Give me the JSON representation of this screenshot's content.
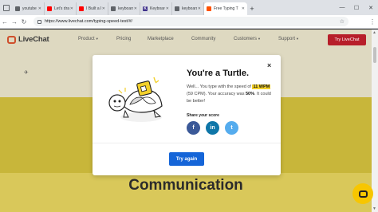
{
  "browser": {
    "tabs": [
      {
        "label": "youtube - Sea",
        "favicon_color": "#5f6368",
        "favicon_glyph": ""
      },
      {
        "label": "Let's draw!",
        "favicon_color": "#ff0000",
        "favicon_glyph": ""
      },
      {
        "label": "I Built a Keybo",
        "favicon_color": "#ff0000",
        "favicon_glyph": ""
      },
      {
        "label": "keyboard tes",
        "favicon_color": "#5f6368",
        "favicon_glyph": ""
      },
      {
        "label": "Keyboard Tes",
        "favicon_color": "#3d2f8a",
        "favicon_glyph": "K"
      },
      {
        "label": "keyboard spe",
        "favicon_color": "#5f6368",
        "favicon_glyph": ""
      },
      {
        "label": "Free Typing T",
        "favicon_color": "#ff5100",
        "favicon_glyph": "",
        "active": true
      }
    ],
    "new_tab": "+",
    "url": "https://www.livechat.com/typing-speed-test/#/"
  },
  "site": {
    "logo_text": "LiveChat",
    "nav": [
      {
        "label": "Product",
        "dropdown": true
      },
      {
        "label": "Pricing",
        "dropdown": false
      },
      {
        "label": "Marketplace",
        "dropdown": false
      },
      {
        "label": "Community",
        "dropdown": false
      },
      {
        "label": "Customers",
        "dropdown": true
      },
      {
        "label": "Support",
        "dropdown": true
      }
    ],
    "cta": "Try LiveChat",
    "heading": "Communication",
    "brand_color": "#b71e2a"
  },
  "modal": {
    "title": "You're a Turtle.",
    "text_1": "Well... You type with the speed of ",
    "wpm": "11 WPM",
    "text_2": " (59 CPM). Your accuracy was ",
    "accuracy": "50%",
    "text_3": ". It could be better!",
    "share_label": "Share your score",
    "share": [
      {
        "network": "facebook",
        "glyph": "f",
        "color": "#3b5998"
      },
      {
        "network": "linkedin",
        "glyph": "in",
        "color": "#0e76a8"
      },
      {
        "network": "twitter",
        "glyph": "t",
        "color": "#55acee"
      }
    ],
    "button": "Try again",
    "close": "×"
  }
}
